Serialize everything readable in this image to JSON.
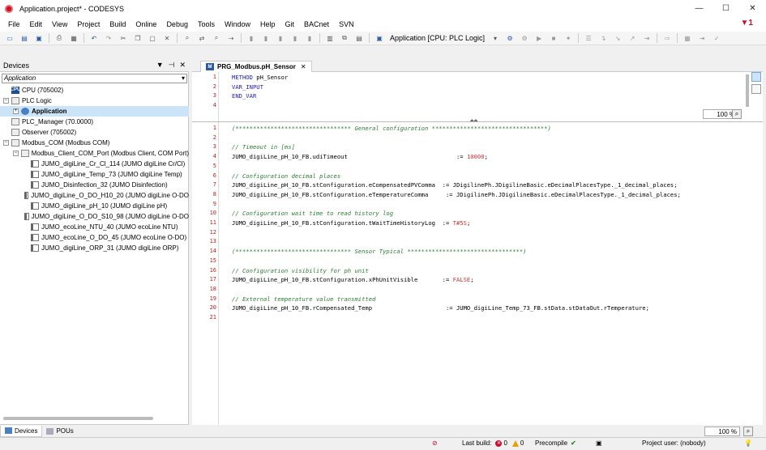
{
  "window": {
    "title": "Application.project* - CODESYS",
    "minimize": "—",
    "maximize": "☐",
    "close": "✕"
  },
  "menu": [
    "File",
    "Edit",
    "View",
    "Project",
    "Build",
    "Online",
    "Debug",
    "Tools",
    "Window",
    "Help",
    "Git",
    "BACnet",
    "SVN"
  ],
  "toolbar": {
    "active_application": "Application [CPU: PLC Logic]"
  },
  "devices_panel": {
    "title": "Devices",
    "header_buttons": [
      "▼",
      "📌",
      "✕"
    ],
    "application_combo": "Application",
    "tree": [
      {
        "label": "CPU (705002)",
        "icon": "cpu-icon",
        "level": 0,
        "expander": "",
        "cls": "cpu",
        "glyph": "CPU"
      },
      {
        "label": "PLC Logic",
        "icon": "plc-logic-icon",
        "level": 0,
        "expander": "−",
        "cls": "plc",
        "glyph": ""
      },
      {
        "label": "Application",
        "icon": "application-icon",
        "level": 1,
        "expander": "+",
        "cls": "app",
        "glyph": "",
        "selected": true
      },
      {
        "label": "PLC_Manager (70.0000)",
        "icon": "plc-device-icon",
        "level": 0,
        "expander": "",
        "cls": "plc",
        "glyph": ""
      },
      {
        "label": "Observer (705002)",
        "icon": "plc-device-icon",
        "level": 0,
        "expander": "",
        "cls": "plc",
        "glyph": ""
      },
      {
        "label": "Modbus_COM (Modbus COM)",
        "icon": "modbus-com-icon",
        "level": 0,
        "expander": "−",
        "cls": "plc",
        "glyph": ""
      },
      {
        "label": "Modbus_Client_COM_Port (Modbus Client, COM Port)",
        "icon": "modbus-client-icon",
        "level": 1,
        "expander": "−",
        "cls": "plc",
        "glyph": ""
      },
      {
        "label": "JUMO_digiLine_Cr_Cl_114 (JUMO digiLine Cr/Cl)",
        "icon": "module-icon",
        "level": 2,
        "expander": "",
        "cls": "mod",
        "glyph": ""
      },
      {
        "label": "JUMO_digiLine_Temp_73 (JUMO digiLine Temp)",
        "icon": "module-icon",
        "level": 2,
        "expander": "",
        "cls": "mod",
        "glyph": ""
      },
      {
        "label": "JUMO_Disinfection_32 (JUMO Disinfection)",
        "icon": "module-icon",
        "level": 2,
        "expander": "",
        "cls": "mod",
        "glyph": ""
      },
      {
        "label": "JUMO_digiLine_O_DO_H10_20 (JUMO digiLine O-DO",
        "icon": "module-icon",
        "level": 2,
        "expander": "",
        "cls": "mod",
        "glyph": ""
      },
      {
        "label": "JUMO_digiLine_pH_10 (JUMO digiLine pH)",
        "icon": "module-icon",
        "level": 2,
        "expander": "",
        "cls": "mod",
        "glyph": ""
      },
      {
        "label": "JUMO_digiLine_O_DO_S10_98 (JUMO digiLine O-DO",
        "icon": "module-icon",
        "level": 2,
        "expander": "",
        "cls": "mod",
        "glyph": ""
      },
      {
        "label": "JUMO_ecoLine_NTU_40 (JUMO ecoLine NTU)",
        "icon": "module-icon",
        "level": 2,
        "expander": "",
        "cls": "mod",
        "glyph": ""
      },
      {
        "label": "JUMO_ecoLine_O_DO_45 (JUMO ecoLine O-DO)",
        "icon": "module-icon",
        "level": 2,
        "expander": "",
        "cls": "mod",
        "glyph": ""
      },
      {
        "label": "JUMO_digiLine_ORP_31 (JUMO digiLine ORP)",
        "icon": "module-icon",
        "level": 2,
        "expander": "",
        "cls": "mod",
        "glyph": ""
      }
    ],
    "tabs": [
      "Devices",
      "POUs"
    ]
  },
  "editor": {
    "tab_title": "PRG_Modbus.pH_Sensor",
    "tab_icon_glyph": "M",
    "tab_close": "✕",
    "declaration": [
      {
        "n": "1",
        "html": "<span class=\"kw\">METHOD</span> pH_Sensor"
      },
      {
        "n": "2",
        "html": "<span class=\"kw\">VAR_INPUT</span>"
      },
      {
        "n": "3",
        "html": "<span class=\"kw\">END_VAR</span>"
      },
      {
        "n": "4",
        "html": ""
      }
    ],
    "implementation": [
      {
        "n": "1",
        "html": "<span class=\"cm\">(********************************* General configuration *********************************)</span>"
      },
      {
        "n": "2",
        "html": ""
      },
      {
        "n": "3",
        "html": "<span class=\"cm\">// Timeout in [ms]</span>"
      },
      {
        "n": "4",
        "html": "JUMO_digiLine_pH_10_FB.udiTimeout                               := <span class=\"st\">10000</span>;"
      },
      {
        "n": "5",
        "html": ""
      },
      {
        "n": "6",
        "html": "<span class=\"cm\">// Configuration decimal places</span>"
      },
      {
        "n": "7",
        "html": "JUMO_digiLine_pH_10_FB.stConfiguration.eCompensatedPVComma  := JDigilinePh.JDigilineBasic.eDecimalPlacesType._1_decimal_places;"
      },
      {
        "n": "8",
        "html": "JUMO_digiLine_pH_10_FB.stConfiguration.eTemperatureComma     := JDigilinePh.JDigilineBasic.eDecimalPlacesType._1_decimal_places;"
      },
      {
        "n": "9",
        "html": ""
      },
      {
        "n": "10",
        "html": "<span class=\"cm\">// Configuration wait time to read history log</span>"
      },
      {
        "n": "11",
        "html": "JUMO_digiLine_pH_10_FB.stConfiguration.tWaitTimeHistoryLog  := <span class=\"st\">T#5S</span>;"
      },
      {
        "n": "12",
        "html": ""
      },
      {
        "n": "13",
        "html": ""
      },
      {
        "n": "14",
        "html": "<span class=\"cm\">(********************************* Sensor Typical *********************************)</span>"
      },
      {
        "n": "15",
        "html": ""
      },
      {
        "n": "16",
        "html": "<span class=\"cm\">// Configuration visibility for ph unit</span>"
      },
      {
        "n": "17",
        "html": "JUMO_digiLine_pH_10_FB.stConfiguration.xPhUnitVisible       := <span class=\"st\">FALSE</span>;"
      },
      {
        "n": "18",
        "html": ""
      },
      {
        "n": "19",
        "html": "<span class=\"cm\">// External temperature value transmitted</span>"
      },
      {
        "n": "20",
        "html": "JUMO_digiLine_pH_10_FB.rCompensated_Temp                     := JUMO_digiLine_Temp_73_FB.stData.stDataOut.rTemperature;"
      },
      {
        "n": "21",
        "html": ""
      }
    ],
    "zoom_declaration": "100 %",
    "zoom_implementation": "100 %"
  },
  "status": {
    "last_build_label": "Last build:",
    "errors": "0",
    "warnings": "0",
    "precompile_label": "Precompile",
    "project_user": "Project user: (nobody)"
  },
  "colors": {
    "accent": "#c8102e",
    "keyword": "#2020c0",
    "comment": "#2e7d32",
    "literal": "#d03030",
    "line_number": "#c02020",
    "selection": "#cce4f7"
  }
}
